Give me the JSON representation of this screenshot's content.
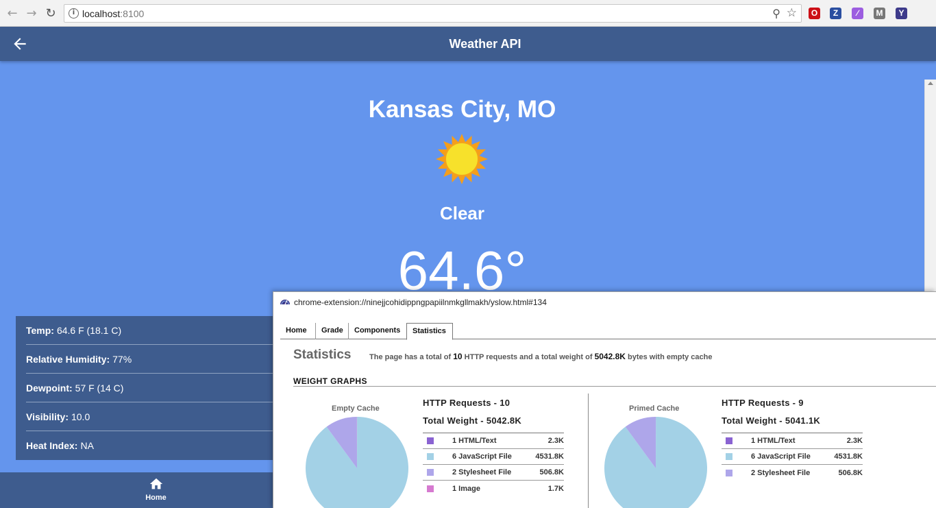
{
  "browser": {
    "url_host": "localhost",
    "url_port": ":8100",
    "extensions": [
      {
        "name": "opera-icon",
        "color": "#cc0f16",
        "glyph": "O"
      },
      {
        "name": "z-extension-icon",
        "color": "#2a4ea0",
        "glyph": "Z"
      },
      {
        "name": "feather-icon",
        "color": "#9c5de0",
        "glyph": "∕"
      },
      {
        "name": "m-extension-icon",
        "color": "#777777",
        "glyph": "M"
      },
      {
        "name": "yslow-extension-icon",
        "color": "#3d3a8a",
        "glyph": "Y"
      }
    ]
  },
  "app": {
    "title": "Weather API",
    "city": "Kansas City, MO",
    "condition": "Clear",
    "temperature": "64.6°",
    "details": [
      {
        "label": "Temp:",
        "value": "64.6 F (18.1 C)"
      },
      {
        "label": "Relative Humidity:",
        "value": "77%"
      },
      {
        "label": "Dewpoint:",
        "value": "57 F (14 C)"
      },
      {
        "label": "Visibility:",
        "value": "10.0"
      },
      {
        "label": "Heat Index:",
        "value": "NA"
      }
    ],
    "tab_home": "Home"
  },
  "yslow": {
    "url": "chrome-extension://ninejjcohidippngpapiilnmkgllmakh/yslow.html#134",
    "tabs": [
      "Home",
      "Grade",
      "Components",
      "Statistics"
    ],
    "heading": "Statistics",
    "summary": {
      "pre": "The page has a total of",
      "requests": "10",
      "mid": "HTTP requests and a total weight of",
      "weight": "5042.8K",
      "post": "bytes with empty cache"
    },
    "weight_graphs": "WEIGHT GRAPHS",
    "empty": {
      "label": "Empty Cache",
      "requests": "HTTP Requests - 10",
      "total_weight": "Total Weight - 5042.8K",
      "rows": [
        {
          "name": "1 HTML/Text",
          "size": "2.3K",
          "color": "#8a63d2"
        },
        {
          "name": "6 JavaScript File",
          "size": "4531.8K",
          "color": "#a3d1e6"
        },
        {
          "name": "2 Stylesheet File",
          "size": "506.8K",
          "color": "#aea6ea"
        },
        {
          "name": "1 Image",
          "size": "1.7K",
          "color": "#d67ad0"
        }
      ]
    },
    "primed": {
      "label": "Primed Cache",
      "requests": "HTTP Requests - 9",
      "total_weight": "Total Weight - 5041.1K",
      "rows": [
        {
          "name": "1 HTML/Text",
          "size": "2.3K",
          "color": "#8a63d2"
        },
        {
          "name": "6 JavaScript File",
          "size": "4531.8K",
          "color": "#a3d1e6"
        },
        {
          "name": "2 Stylesheet File",
          "size": "506.8K",
          "color": "#aea6ea"
        }
      ]
    }
  }
}
